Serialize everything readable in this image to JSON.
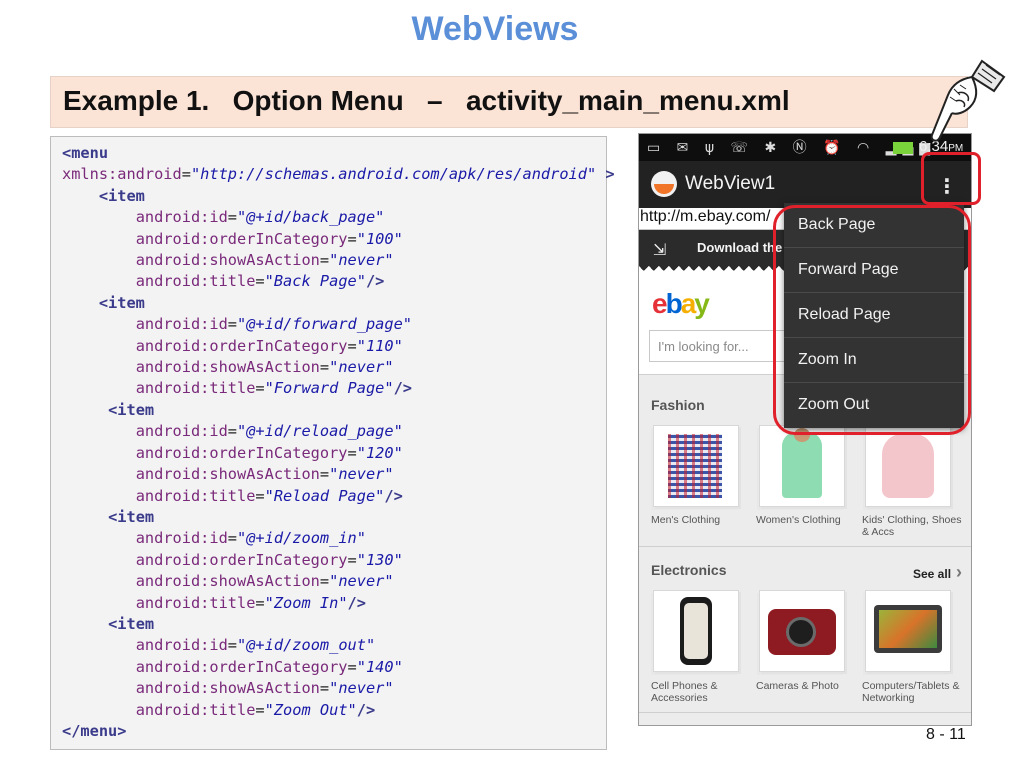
{
  "slide": {
    "title": "WebViews",
    "example_heading": "Example 1.   Option Menu   –   activity_main_menu.xml",
    "slide_number": "8 - 11"
  },
  "code": {
    "menu_open": "<menu",
    "xmlns_attr": "xmlns:android",
    "xmlns_value": "\"http://schemas.android.com/apk/res/android\"",
    "xmlns_close": " >",
    "item_open": "<item",
    "attr_id": "android:id",
    "attr_order": "android:orderInCategory",
    "attr_show": "android:showAsAction",
    "attr_title": "android:title",
    "self_close": "/>",
    "menu_close": "</menu>",
    "items": [
      {
        "id": "\"@+id/back_page\"",
        "order": "\"100\"",
        "show": "\"never\"",
        "title": "\"Back Page\""
      },
      {
        "id": "\"@+id/forward_page\"",
        "order": "\"110\"",
        "show": "\"never\"",
        "title": "\"Forward Page\""
      },
      {
        "id": "\"@+id/reload_page\"",
        "order": "\"120\"",
        "show": "\"never\"",
        "title": "\"Reload Page\""
      },
      {
        "id": "\"@+id/zoom_in\"",
        "order": "\"130\"",
        "show": "\"never\"",
        "title": "\"Zoom In\""
      },
      {
        "id": "\"@+id/zoom_out\"",
        "order": "\"140\"",
        "show": "\"never\"",
        "title": "\"Zoom Out\""
      }
    ]
  },
  "phone": {
    "clock": "6:34",
    "clock_suffix": "PM",
    "app_title": "WebView1",
    "url": "http://m.ebay.com/",
    "download_text": "Download the",
    "ebay_logo": {
      "e": "e",
      "b": "b",
      "a": "a",
      "y": "y",
      "colors": [
        "#e53238",
        "#0064d2",
        "#f5af02",
        "#86b817"
      ]
    },
    "search_placeholder": "I'm looking for...",
    "sections": {
      "fashion": {
        "title": "Fashion",
        "items": [
          "Men's Clothing",
          "Women's Clothing",
          "Kids' Clothing, Shoes & Accs"
        ]
      },
      "electronics": {
        "title": "Electronics",
        "see_all": "See all",
        "items": [
          "Cell Phones & Accessories",
          "Cameras & Photo",
          "Computers/Tablets & Networking"
        ]
      }
    }
  },
  "overflow_menu": {
    "items": [
      "Back Page",
      "Forward Page",
      "Reload Page",
      "Zoom In",
      "Zoom Out"
    ]
  },
  "colors": {
    "title_blue": "#5b8fd8",
    "highlight_red": "#e0202a",
    "banner_bg": "#fbe3d5"
  }
}
